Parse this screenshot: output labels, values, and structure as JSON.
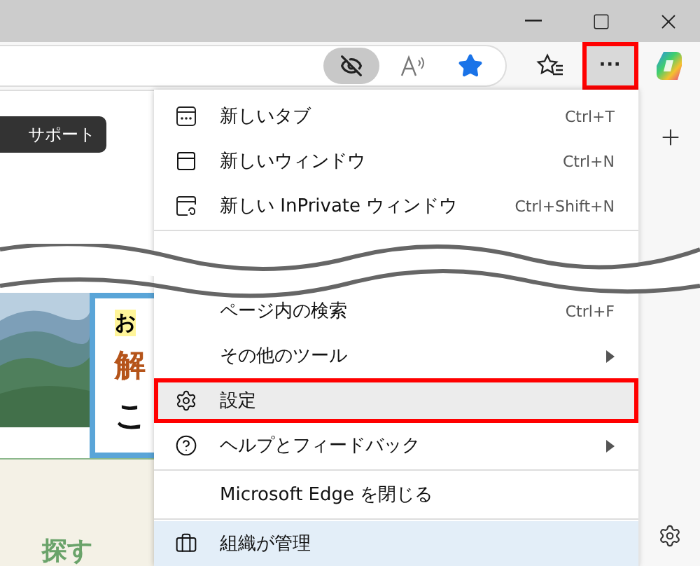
{
  "toolbar": {
    "more_button": {
      "label": "···",
      "selected": true
    }
  },
  "page": {
    "support_button": "サポート",
    "card": {
      "line_1": "お",
      "line_2": "解",
      "line_3": "こ"
    },
    "footer_text": "探す"
  },
  "menu": {
    "groups": [
      [
        {
          "label": "新しいタブ",
          "shortcut": "Ctrl+T",
          "submenu": false,
          "selected": false,
          "kind": "item"
        },
        {
          "label": "新しいウィンドウ",
          "shortcut": "Ctrl+N",
          "submenu": false,
          "selected": false,
          "kind": "item"
        },
        {
          "label": "新しい InPrivate ウィンドウ",
          "shortcut": "Ctrl+Shift+N",
          "submenu": false,
          "selected": false,
          "kind": "item"
        }
      ],
      [
        {
          "label": "ページ内の検索",
          "shortcut": "Ctrl+F",
          "submenu": false,
          "selected": false,
          "kind": "item"
        },
        {
          "label": "その他のツール",
          "submenu": true,
          "selected": false,
          "kind": "item"
        },
        {
          "label": "設定",
          "submenu": false,
          "selected": true,
          "kind": "item"
        },
        {
          "label": "ヘルプとフィードバック",
          "submenu": true,
          "selected": false,
          "kind": "item"
        }
      ],
      [
        {
          "label": "Microsoft Edge を閉じる",
          "submenu": false,
          "selected": false,
          "kind": "item"
        }
      ],
      [
        {
          "label": "組織が管理",
          "submenu": false,
          "selected": false,
          "kind": "managed"
        }
      ]
    ]
  }
}
